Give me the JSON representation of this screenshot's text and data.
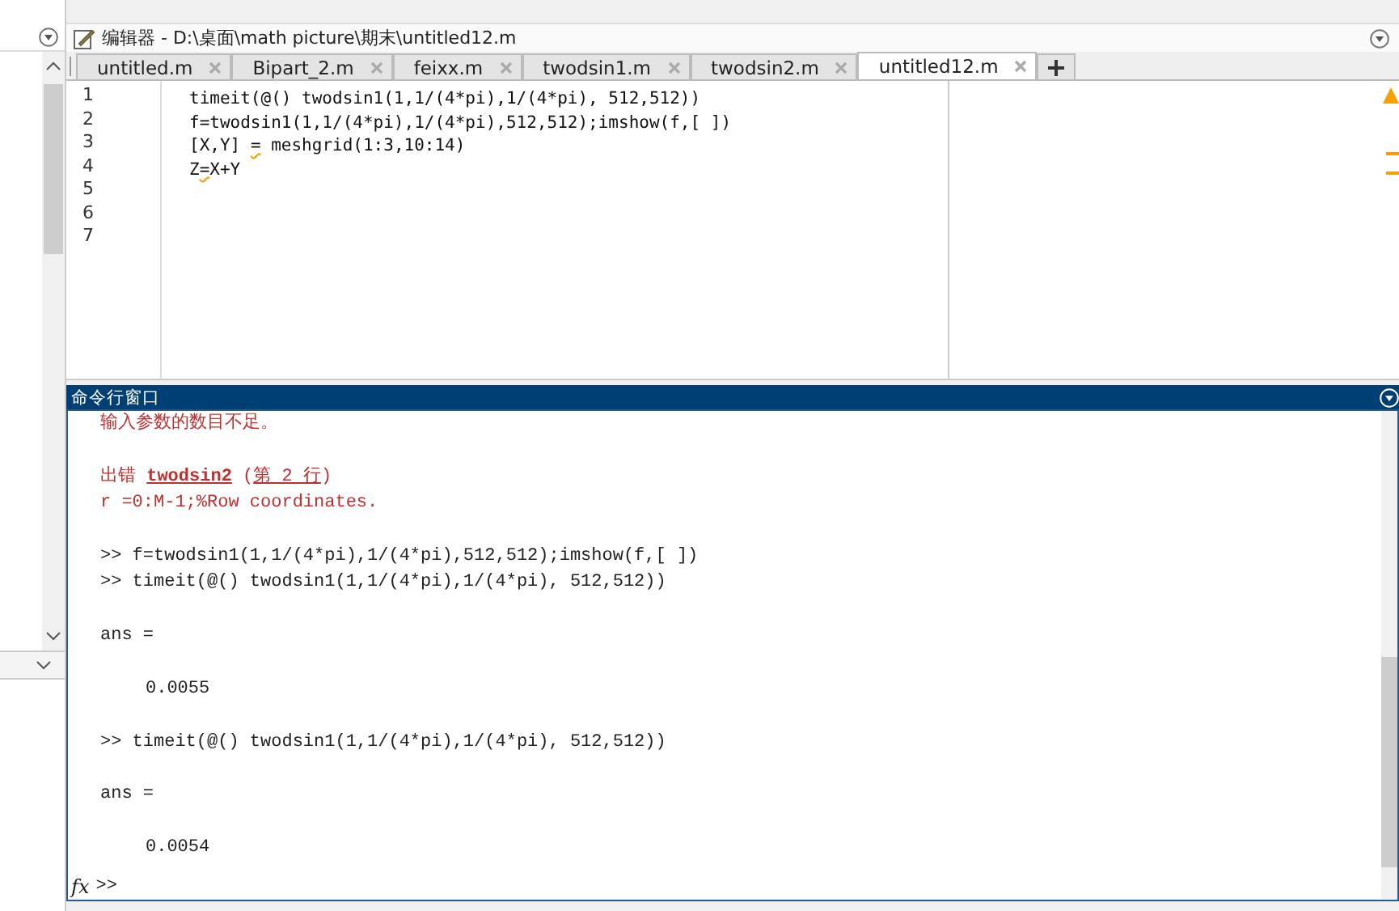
{
  "editor": {
    "title": "编辑器 - D:\\桌面\\math picture\\期末\\untitled12.m",
    "tabs": [
      {
        "label": "untitled.m",
        "selected": false
      },
      {
        "label": "Bipart_2.m",
        "selected": false
      },
      {
        "label": "feixx.m",
        "selected": false
      },
      {
        "label": "twodsin1.m",
        "selected": false
      },
      {
        "label": "twodsin2.m",
        "selected": false
      },
      {
        "label": "untitled12.m",
        "selected": true
      }
    ],
    "lines": [
      {
        "number": "1",
        "parts": [
          {
            "text": "timeit(@() twodsin1(1,1/(4*pi),1/(4*pi), 512,512))",
            "warning": false
          }
        ]
      },
      {
        "number": "2",
        "parts": [
          {
            "text": "f=twodsin1(1,1/(4*pi),1/(4*pi),512,512);imshow(f,[ ])",
            "warning": false
          }
        ]
      },
      {
        "number": "3",
        "parts": [
          {
            "text": "[X,Y] ",
            "warning": false
          },
          {
            "text": "=",
            "warning": true
          },
          {
            "text": " meshgrid(1:3,10:14)",
            "warning": false
          }
        ]
      },
      {
        "number": "4",
        "parts": [
          {
            "text": "Z",
            "warning": false
          },
          {
            "text": "=",
            "warning": true
          },
          {
            "text": "X+Y",
            "warning": false
          }
        ]
      },
      {
        "number": "5"
      },
      {
        "number": "6"
      },
      {
        "number": "7"
      }
    ]
  },
  "command_window": {
    "title": "命令行窗口",
    "lines": [
      {
        "kind": "error",
        "parts": [
          {
            "text": "输入参数的数目不足。",
            "kind": "plain"
          }
        ]
      },
      {
        "kind": "blank"
      },
      {
        "kind": "error",
        "parts": [
          {
            "text": "出错 ",
            "kind": "plain"
          },
          {
            "text": "twodsin2",
            "kind": "link-bold"
          },
          {
            "text": " (",
            "kind": "plain"
          },
          {
            "text": "第 2 行",
            "kind": "link"
          },
          {
            "text": ")",
            "kind": "plain"
          }
        ]
      },
      {
        "kind": "error",
        "parts": [
          {
            "text": "r =0:M-1;%Row coordinates.",
            "kind": "plain"
          }
        ]
      },
      {
        "kind": "blank"
      },
      {
        "kind": "output",
        "parts": [
          {
            "text": ">> f=twodsin1(1,1/(4*pi),1/(4*pi),512,512);imshow(f,[ ])",
            "kind": "plain"
          }
        ]
      },
      {
        "kind": "output",
        "parts": [
          {
            "text": ">> timeit(@() twodsin1(1,1/(4*pi),1/(4*pi), 512,512))",
            "kind": "plain"
          }
        ]
      },
      {
        "kind": "blank"
      },
      {
        "kind": "output",
        "parts": [
          {
            "text": "ans =",
            "kind": "plain"
          }
        ]
      },
      {
        "kind": "blank"
      },
      {
        "kind": "result",
        "parts": [
          {
            "text": "0.0055",
            "kind": "plain"
          }
        ]
      },
      {
        "kind": "blank"
      },
      {
        "kind": "output",
        "parts": [
          {
            "text": ">> timeit(@() twodsin1(1,1/(4*pi),1/(4*pi), 512,512))",
            "kind": "plain"
          }
        ]
      },
      {
        "kind": "blank"
      },
      {
        "kind": "output",
        "parts": [
          {
            "text": "ans =",
            "kind": "plain"
          }
        ]
      },
      {
        "kind": "blank"
      },
      {
        "kind": "result",
        "parts": [
          {
            "text": "0.0054",
            "kind": "plain"
          }
        ]
      }
    ],
    "fx_label": "fx",
    "prompt": ">>"
  }
}
